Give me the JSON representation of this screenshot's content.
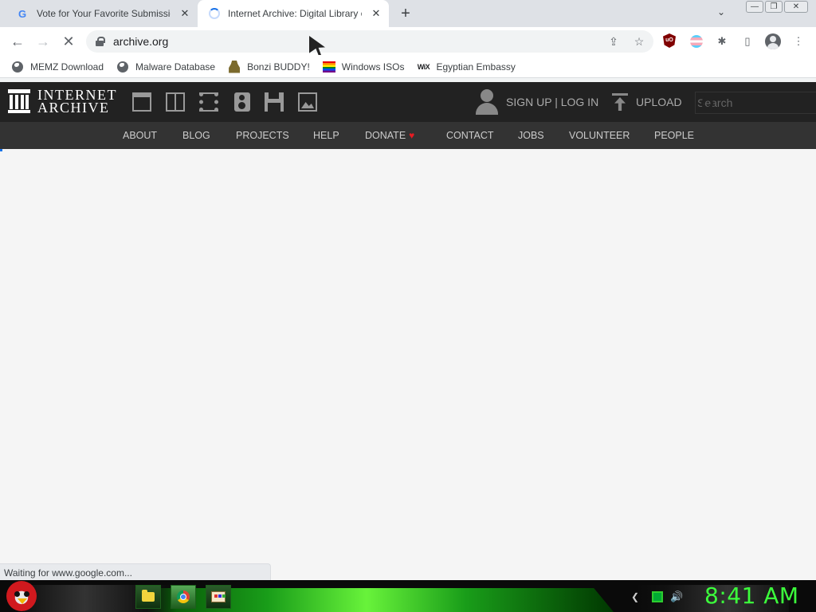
{
  "browser": {
    "tabs": [
      {
        "title": "Vote for Your Favorite Submission",
        "favicon": "google-g-icon",
        "close": "✕"
      },
      {
        "title": "Internet Archive: Digital Library of",
        "favicon": "loading-spinner-icon",
        "close": "✕"
      }
    ],
    "new_tab": "+",
    "tab_search": "⌄",
    "window_buttons": {
      "minimize": "—",
      "maximize": "❐",
      "close": "✕"
    },
    "nav": {
      "back": "←",
      "forward": "→",
      "reload": "✕"
    },
    "url": "archive.org",
    "omnibox_icons": {
      "share": "⇪",
      "star": "☆"
    },
    "extensions": {
      "puzzle": "✱",
      "sidepanel": "▯",
      "menu": "⋮"
    },
    "ublock_label": "uO"
  },
  "bookmarks": [
    {
      "label": "MEMZ Download",
      "icon": "globe-icon"
    },
    {
      "label": "Malware Database",
      "icon": "globe-icon"
    },
    {
      "label": "Bonzi BUDDY!",
      "icon": "bonzi-icon"
    },
    {
      "label": "Windows ISOs",
      "icon": "rainbow-flag-icon"
    },
    {
      "label": "Egyptian Embassy",
      "icon": "wix-icon",
      "icon_text": "WiX"
    }
  ],
  "ia": {
    "logo_line1": "INTERNET",
    "logo_line2": "ARCHIVE",
    "signup": "SIGN UP | LOG IN",
    "upload": "UPLOAD",
    "search_placeholder": "Search",
    "nav": [
      "ABOUT",
      "BLOG",
      "PROJECTS",
      "HELP",
      "DONATE",
      "CONTACT",
      "JOBS",
      "VOLUNTEER",
      "PEOPLE"
    ],
    "donate_heart": "♥",
    "brand_color": "#222222"
  },
  "status": "Waiting for www.google.com...",
  "taskbar": {
    "clock": "8:41 AM",
    "apps": [
      "folder-icon",
      "chrome-icon",
      "paint-icon"
    ],
    "tray_chevron": "❮",
    "tray_speaker": "🔊"
  }
}
